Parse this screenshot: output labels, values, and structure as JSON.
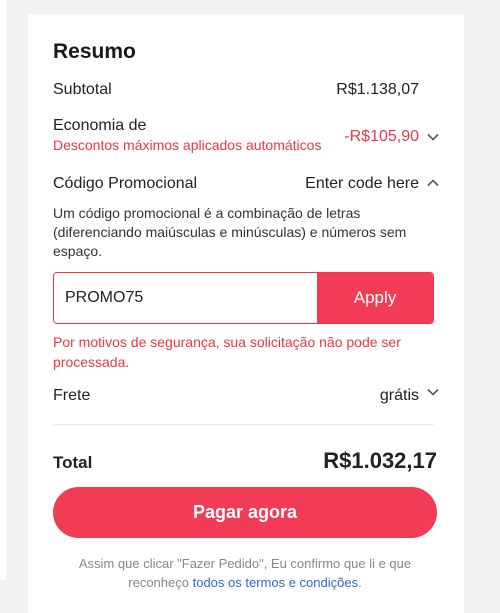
{
  "summary": {
    "title": "Resumo",
    "subtotal_label": "Subtotal",
    "subtotal_value": "R$1.138,07",
    "savings_label": "Economia de",
    "savings_note": "Descontos máximos aplicados automáticos",
    "savings_value": "-R$105,90",
    "promo_label": "Código Promocional",
    "promo_toggle": "Enter code here",
    "promo_description": "Um código promocional é a combinação de letras (diferenciando maiúsculas e minúsculas) e números sem espaço.",
    "promo_input_value": "PROMO75",
    "apply_label": "Apply",
    "promo_error": "Por motivos de segurança, sua solicitação não pode ser processada.",
    "shipping_label": "Frete",
    "shipping_value": "grátis",
    "total_label": "Total",
    "total_value": "R$1.032,17",
    "pay_label": "Pagar agora",
    "footer_text": "Assim que clicar \"Fazer Pedido\", Eu confirmo que li e que reconheço",
    "footer_link": "todos os termos e condições",
    "footer_end": "."
  },
  "icons": {
    "savings_chevron": "chevron-down-icon",
    "promo_chevron": "chevron-up-icon",
    "shipping_chevron": "chevron-down-icon"
  },
  "colors": {
    "accent": "#f23b55",
    "error": "#f03545",
    "link": "#2b6ad1"
  }
}
